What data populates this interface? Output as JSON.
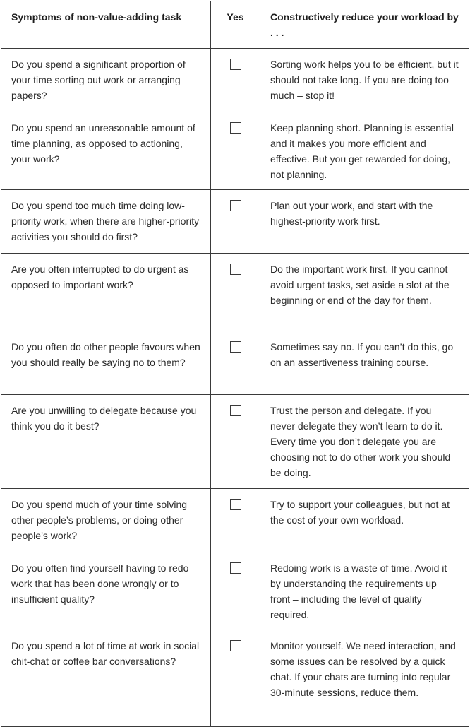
{
  "table": {
    "headers": {
      "symptom": "Symptoms of non-value-adding task",
      "yes": "Yes",
      "reduce": "Constructively reduce your workload by . . ."
    },
    "rows": [
      {
        "symptom": "Do you spend a significant proportion of your time sorting out work or arranging papers?",
        "checked": false,
        "reduce": "Sorting work helps you to be efficient, but it should not take long. If you are doing too much – stop it!"
      },
      {
        "symptom": "Do you spend an unreasonable amount of time planning, as opposed to actioning, your work?",
        "checked": false,
        "reduce": "Keep planning short. Planning is essential and it makes you more efficient and effective. But you get rewarded for doing, not planning."
      },
      {
        "symptom": "Do you spend too much time doing low-priority work, when there are higher-priority activities you should do first?",
        "checked": false,
        "reduce": "Plan out your work, and start with the highest-priority work first."
      },
      {
        "symptom": "Are you often interrupted to do urgent as opposed to important work?",
        "checked": false,
        "reduce": "Do the important work first. If you cannot avoid urgent tasks, set aside a slot at the beginning or end of the day for them."
      },
      {
        "symptom": "Do you often do other people favours when you should really be saying no to them?",
        "checked": false,
        "reduce": "Sometimes say no. If you can’t do this, go on an assertiveness training course."
      },
      {
        "symptom": "Are you unwilling to delegate because you think you do it best?",
        "checked": false,
        "reduce": "Trust the person and delegate. If you never delegate they won’t learn to do it. Every time you don’t delegate you are choosing not to do other work you should be doing."
      },
      {
        "symptom": "Do you spend much of your time solving other people’s problems, or doing other people’s work?",
        "checked": false,
        "reduce": "Try to support your colleagues, but not at the cost of your own workload."
      },
      {
        "symptom": "Do you often find yourself having to redo work that has been done wrongly or to insufficient quality?",
        "checked": false,
        "reduce": "Redoing work is a waste of time. Avoid it by understanding the requirements up front – including the level of quality required."
      },
      {
        "symptom": "Do you spend a lot of time at work in social chit-chat or coffee bar conversations?",
        "checked": false,
        "reduce": "Monitor yourself. We need interaction, and some issues can be resolved by a quick chat. If your chats are turning into regular 30-minute sessions, reduce them."
      }
    ]
  }
}
